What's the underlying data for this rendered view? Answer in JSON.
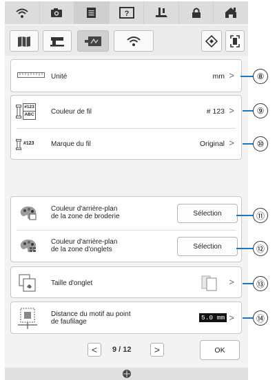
{
  "rows": {
    "unit": {
      "label": "Unité",
      "value": "mm",
      "icon": "ruler-icon"
    },
    "thread_color": {
      "label": "Couleur de fil",
      "value": "# 123",
      "icon_code": "#123",
      "icon_code2": "ABC"
    },
    "thread_brand": {
      "label": "Marque du fil",
      "value": "Original",
      "icon_code": "#123"
    },
    "bg_embroidery": {
      "line1": "Couleur d'arrière-plan",
      "line2": "de la zone de broderie",
      "button": "Sélection"
    },
    "bg_tabs": {
      "line1": "Couleur d'arrière-plan",
      "line2": "de la zone d'onglets",
      "button": "Sélection"
    },
    "tab_size": {
      "label": "Taille d'onglet"
    },
    "basting": {
      "line1": "Distance du motif au point",
      "line2": "de faufilage",
      "value": "5.0 mm"
    }
  },
  "nav": {
    "prev": "<",
    "next": ">",
    "page": "9 / 12",
    "ok": "OK"
  },
  "callouts": [
    "⑧",
    "⑨",
    "⑩",
    "⑪",
    "⑫",
    "⑬",
    "⑭"
  ],
  "colors": {
    "callout_line": "#1a74c9",
    "top_bar": "#dcdcdc",
    "screen_bg": "#f3f3f3"
  }
}
